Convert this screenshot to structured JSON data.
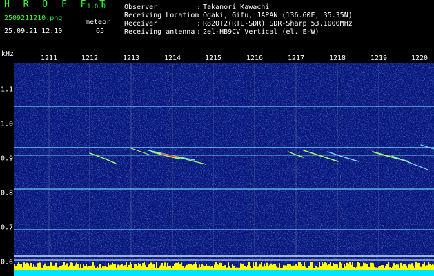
{
  "app": {
    "logo": "H R O F F T",
    "version": "1.0.0"
  },
  "file_name": "2509211210.png",
  "timestamp": "25.09.21 12:10",
  "meteor": {
    "label": "meteor",
    "count": "65"
  },
  "info": [
    {
      "label": "Observer",
      "value": "Takanori Kawachi"
    },
    {
      "label": "Receiving Location",
      "value": "Ogaki, Gifu, JAPAN (136.60E, 35.35N)"
    },
    {
      "label": "Receiver",
      "value": "R820T2(RTL-SDR) SDR-Sharp 53.1000MHz"
    },
    {
      "label": "Receiving antenna",
      "value": "2el-HB9CV Vertical (el. E-W)"
    }
  ],
  "axis": {
    "unit": "kHz",
    "time_ticks": [
      "1211",
      "1212",
      "1213",
      "1214",
      "1215",
      "1216",
      "1217",
      "1218",
      "1219",
      "1220"
    ],
    "freq_ticks": [
      "1.1",
      "1.0",
      "0.9",
      "0.8",
      "0.7",
      "0.6"
    ]
  },
  "colors": {
    "background": "#0a1478",
    "header_green": "#33ff33",
    "carrier_line": "#78e0ff",
    "echo": "#a0ff60",
    "echo_hot": "#ff3030",
    "signal_base": "#00e5ff",
    "signal_peak": "#ffff00"
  }
}
